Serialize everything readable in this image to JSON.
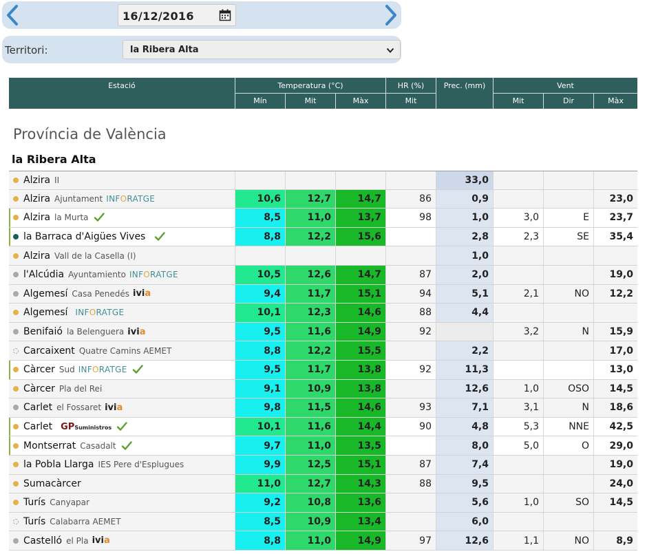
{
  "date_bar": {
    "date_value": "16/12/2016",
    "prev_icon": "chevron-left-icon",
    "next_icon": "chevron-right-icon",
    "calendar_icon": "calendar-icon"
  },
  "territory": {
    "label": "Territori:",
    "selected": "la Ribera Alta"
  },
  "table_header": {
    "station": "Estació",
    "temperature": "Temperatura (°C)",
    "humidity": "HR (%)",
    "precipitation": "Prec. (mm)",
    "wind": "Vent",
    "min": "Mín",
    "mit": "Mit",
    "max": "Màx",
    "hr_mit": "Mit",
    "wind_mit": "Mit",
    "wind_dir": "Dir",
    "wind_max": "Màx"
  },
  "province": "Província de València",
  "region": "la Ribera Alta",
  "colors": {
    "header_bg": "#2f5f5c",
    "tmin_bg": "#18f0f0",
    "tmin_alt_bg": "#22e890",
    "tmit_bg": "#2fd86a",
    "tmax_bg": "#18b828",
    "prec_bg": "#dde5f1",
    "dot_yellow": "#e4b24a",
    "dot_gray": "#a9a9a9",
    "dot_teal": "#1b5e5a",
    "check_green": "#5aa02c"
  },
  "stations": [
    {
      "name": "Alzira",
      "desc": "II",
      "brand": "",
      "check": false,
      "own": false,
      "dot": "#e4b24a",
      "tmin": "",
      "tmit": "",
      "tmax": "",
      "hr": "",
      "prec": "33,0",
      "prec_shade": "#cdd8ea",
      "vmit": "",
      "vdir": "",
      "vmax": "",
      "tmin_color": ""
    },
    {
      "name": "Alzira",
      "desc": "Ajuntament",
      "brand": "inforatge",
      "check": false,
      "own": false,
      "dot": "#e4b24a",
      "tmin": "10,6",
      "tmit": "12,7",
      "tmax": "14,7",
      "hr": "86",
      "prec": "0,9",
      "vmit": "",
      "vdir": "",
      "vmax": "23,0",
      "tmin_color": "#22e890"
    },
    {
      "name": "Alzira",
      "desc": "la Murta",
      "brand": "",
      "check": true,
      "own": true,
      "dot": "#e4b24a",
      "tmin": "8,5",
      "tmit": "11,0",
      "tmax": "13,7",
      "hr": "98",
      "prec": "1,0",
      "vmit": "3,0",
      "vdir": "E",
      "vmax": "23,7",
      "tmin_color": "#18f0f0"
    },
    {
      "name": "la Barraca d'Aigües Vives",
      "desc": "",
      "brand": "",
      "check": true,
      "own": true,
      "dot": "#1b5e5a",
      "tmin": "8,8",
      "tmit": "12,2",
      "tmax": "15,6",
      "hr": "",
      "prec": "2,8",
      "vmit": "2,3",
      "vdir": "SE",
      "vmax": "35,4",
      "tmin_color": "#18f0f0"
    },
    {
      "name": "Alzira",
      "desc": "Vall de la Casella (I)",
      "brand": "",
      "check": false,
      "own": false,
      "dot": "#e4b24a",
      "tmin": "",
      "tmit": "",
      "tmax": "",
      "hr": "",
      "prec": "1,0",
      "vmit": "",
      "vdir": "",
      "vmax": "",
      "tmin_color": ""
    },
    {
      "name": "l'Alcúdia",
      "desc": "Ayuntamiento",
      "brand": "inforatge",
      "check": false,
      "own": false,
      "dot": "#a9a9a9",
      "tmin": "10,5",
      "tmit": "12,6",
      "tmax": "14,7",
      "hr": "87",
      "prec": "2,0",
      "vmit": "",
      "vdir": "",
      "vmax": "19,0",
      "tmin_color": "#22e890"
    },
    {
      "name": "Algemesí",
      "desc": "Casa Penedés",
      "brand": "ivia",
      "check": false,
      "own": false,
      "dot": "#a9a9a9",
      "tmin": "9,4",
      "tmit": "11,7",
      "tmax": "15,1",
      "hr": "94",
      "prec": "5,1",
      "vmit": "2,1",
      "vdir": "NO",
      "vmax": "12,2",
      "tmin_color": "#18f0f0"
    },
    {
      "name": "Algemesí",
      "desc": "",
      "brand": "inforatge",
      "check": false,
      "own": false,
      "dot": "#e4b24a",
      "tmin": "10,1",
      "tmit": "12,3",
      "tmax": "14,6",
      "hr": "88",
      "prec": "4,4",
      "vmit": "",
      "vdir": "",
      "vmax": "",
      "tmin_color": "#22e890"
    },
    {
      "name": "Benifaió",
      "desc": "la Belenguera",
      "brand": "ivia",
      "check": false,
      "own": false,
      "dot": "#a9a9a9",
      "tmin": "9,5",
      "tmit": "11,6",
      "tmax": "14,9",
      "hr": "92",
      "prec": "",
      "prec_shade": "#ececec",
      "vmit": "3,2",
      "vdir": "N",
      "vmax": "15,9",
      "tmin_color": "#18f0f0"
    },
    {
      "name": "Carcaixent",
      "desc": "Quatre Camins AEMET",
      "brand": "",
      "check": false,
      "own": false,
      "dot": "hollow",
      "tmin": "8,8",
      "tmit": "12,2",
      "tmax": "15,5",
      "hr": "",
      "prec": "2,2",
      "vmit": "",
      "vdir": "",
      "vmax": "17,0",
      "tmin_color": "#18f0f0"
    },
    {
      "name": "Càrcer",
      "desc": "Sud",
      "brand": "inforatge",
      "check": true,
      "own": true,
      "dot": "#e4b24a",
      "tmin": "9,5",
      "tmit": "11,7",
      "tmax": "13,8",
      "hr": "92",
      "prec": "11,3",
      "vmit": "",
      "vdir": "",
      "vmax": "13,0",
      "tmin_color": "#18f0f0"
    },
    {
      "name": "Càrcer",
      "desc": "Pla del Rei",
      "brand": "",
      "check": false,
      "own": false,
      "dot": "#e4b24a",
      "tmin": "9,1",
      "tmit": "10,9",
      "tmax": "13,8",
      "hr": "",
      "prec": "12,6",
      "vmit": "1,0",
      "vdir": "OSO",
      "vmax": "14,5",
      "tmin_color": "#18f0f0"
    },
    {
      "name": "Carlet",
      "desc": "el Fossaret",
      "brand": "ivia",
      "check": false,
      "own": false,
      "dot": "#a9a9a9",
      "tmin": "9,8",
      "tmit": "11,5",
      "tmax": "14,6",
      "hr": "93",
      "prec": "7,1",
      "vmit": "3,1",
      "vdir": "N",
      "vmax": "18,6",
      "tmin_color": "#18f0f0"
    },
    {
      "name": "Carlet",
      "desc": "",
      "brand": "gp",
      "check": true,
      "own": true,
      "dot": "#e4b24a",
      "tmin": "10,1",
      "tmit": "11,6",
      "tmax": "14,4",
      "hr": "90",
      "prec": "4,8",
      "vmit": "5,3",
      "vdir": "NNE",
      "vmax": "42,5",
      "tmin_color": "#22e890"
    },
    {
      "name": "Montserrat",
      "desc": "Casadalt",
      "brand": "",
      "check": true,
      "own": true,
      "dot": "#e4b24a",
      "tmin": "9,7",
      "tmit": "11,0",
      "tmax": "13,5",
      "hr": "",
      "prec": "8,0",
      "vmit": "5,0",
      "vdir": "O",
      "vmax": "29,0",
      "tmin_color": "#18f0f0"
    },
    {
      "name": "la Pobla Llarga",
      "desc": "IES Pere d'Esplugues",
      "brand": "",
      "check": false,
      "own": false,
      "dot": "#e4b24a",
      "tmin": "9,9",
      "tmit": "12,5",
      "tmax": "15,1",
      "hr": "87",
      "prec": "7,4",
      "vmit": "",
      "vdir": "",
      "vmax": "19,0",
      "tmin_color": "#18f0f0"
    },
    {
      "name": "Sumacàrcer",
      "desc": "",
      "brand": "",
      "check": false,
      "own": false,
      "dot": "#e4b24a",
      "tmin": "11,0",
      "tmit": "12,7",
      "tmax": "14,3",
      "hr": "88",
      "prec": "9,5",
      "vmit": "",
      "vdir": "",
      "vmax": "24,0",
      "tmin_color": "#22e890"
    },
    {
      "name": "Turís",
      "desc": "Canyapar",
      "brand": "",
      "check": false,
      "own": false,
      "dot": "#e4b24a",
      "tmin": "9,2",
      "tmit": "10,8",
      "tmax": "13,6",
      "hr": "",
      "prec": "5,6",
      "vmit": "1,0",
      "vdir": "SO",
      "vmax": "14,5",
      "tmin_color": "#18f0f0"
    },
    {
      "name": "Turís",
      "desc": "Calabarra AEMET",
      "brand": "",
      "check": false,
      "own": false,
      "dot": "hollow",
      "tmin": "8,5",
      "tmit": "10,9",
      "tmax": "13,4",
      "hr": "",
      "prec": "6,0",
      "vmit": "",
      "vdir": "",
      "vmax": "",
      "tmin_color": "#18f0f0"
    },
    {
      "name": "Castelló",
      "desc": "el Pla",
      "brand": "ivia",
      "check": false,
      "own": false,
      "dot": "#a9a9a9",
      "tmin": "8,8",
      "tmit": "11,0",
      "tmax": "14,9",
      "hr": "97",
      "prec": "12,6",
      "vmit": "1,1",
      "vdir": "NO",
      "vmax": "8,9",
      "tmin_color": "#18f0f0"
    }
  ]
}
